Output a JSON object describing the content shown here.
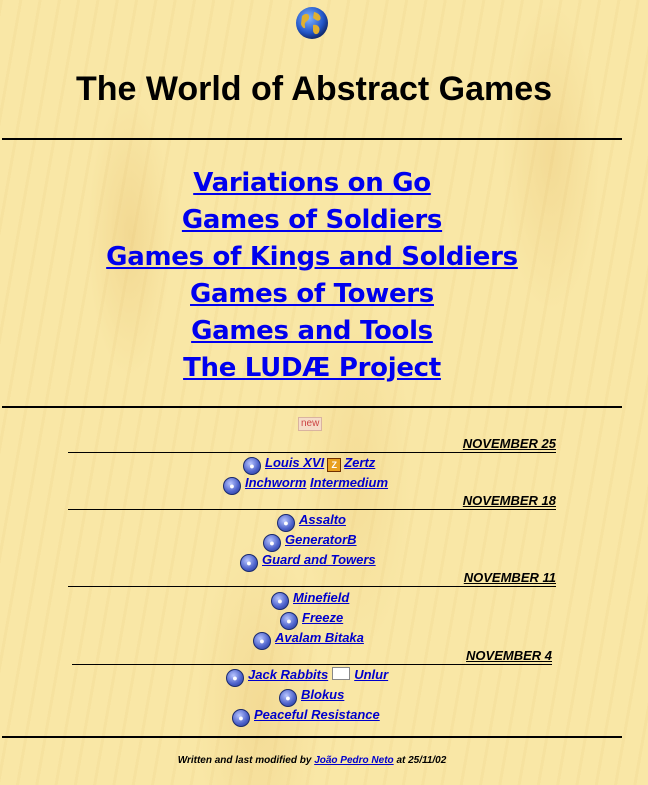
{
  "title": "The World of Abstract Games",
  "main_links": [
    "Variations on Go",
    "Games of Soldiers",
    "Games of Kings and Soldiers",
    "Games of Towers",
    "Games and Tools",
    "The LUDÆ Project"
  ],
  "new_badge": "new",
  "sections": [
    {
      "date": "NOVEMBER 25",
      "rows": [
        [
          "Louis XVI",
          "Zertz"
        ],
        [
          "Inchworm",
          "Intermedium"
        ]
      ]
    },
    {
      "date": "NOVEMBER 18",
      "rows": [
        [
          "Assalto"
        ],
        [
          "GeneratorB"
        ],
        [
          "Guard and Towers"
        ]
      ]
    },
    {
      "date": "NOVEMBER 11",
      "rows": [
        [
          "Minefield"
        ],
        [
          "Freeze"
        ],
        [
          "Avalam Bitaka"
        ]
      ]
    },
    {
      "date": "NOVEMBER 4",
      "rows": [
        [
          "Jack Rabbits",
          "Unlur"
        ],
        [
          "Blokus"
        ],
        [
          "Peaceful Resistance"
        ]
      ]
    }
  ],
  "footer": {
    "prefix": "Written and last modified by",
    "author": "João Pedro Neto",
    "suffix": "at 25/11/02"
  },
  "icons": {
    "globe": "globe-icon",
    "game": "game-ball-icon"
  }
}
